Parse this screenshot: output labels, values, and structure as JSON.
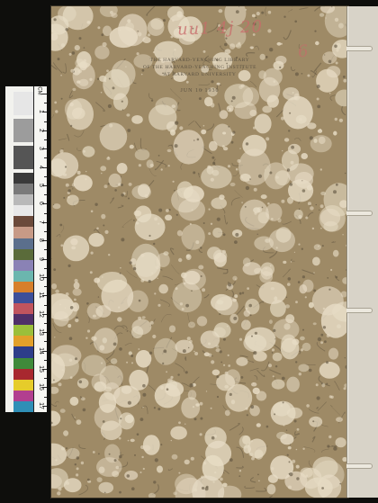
{
  "stamp": {
    "line1": "THE HARVARD-YENCHING LIBRARY",
    "line2": "OF THE HARVARD-YENCHING INSTITUTE",
    "line3": "AT HARVARD UNIVERSITY",
    "date": "JUN 16 1930"
  },
  "handwriting": {
    "call_number": "uu1 4j 20",
    "corner_mark": "6"
  },
  "color_checker": {
    "unit_label": "CM",
    "ruler_numbers": [
      "1",
      "2",
      "3",
      "4",
      "5",
      "6",
      "7",
      "8",
      "9",
      "10",
      "11",
      "12",
      "13",
      "14",
      "15",
      "16",
      "17"
    ],
    "swatch_colors": [
      "#3a3a3a",
      "#7a7a7a",
      "#b9b9b9",
      "#e8e8e8",
      "#6b4a3a",
      "#c79a86",
      "#5b6f8c",
      "#5a6b3a",
      "#8a82b5",
      "#6bb6ae",
      "#d67f2b",
      "#3c4f9a",
      "#c0545e",
      "#4f2f68",
      "#9bbf3a",
      "#e2a02a",
      "#2d3d8a",
      "#3f8a3a",
      "#a8282f",
      "#e6cc2a",
      "#b23f8f",
      "#2f8fb6"
    ]
  },
  "colors": {
    "cover_base": "#9e8a66",
    "cover_light": "#e7dcc5",
    "cover_dark": "#5e523d",
    "spine": "#d8d3c8",
    "background": "#0e0e0c"
  }
}
